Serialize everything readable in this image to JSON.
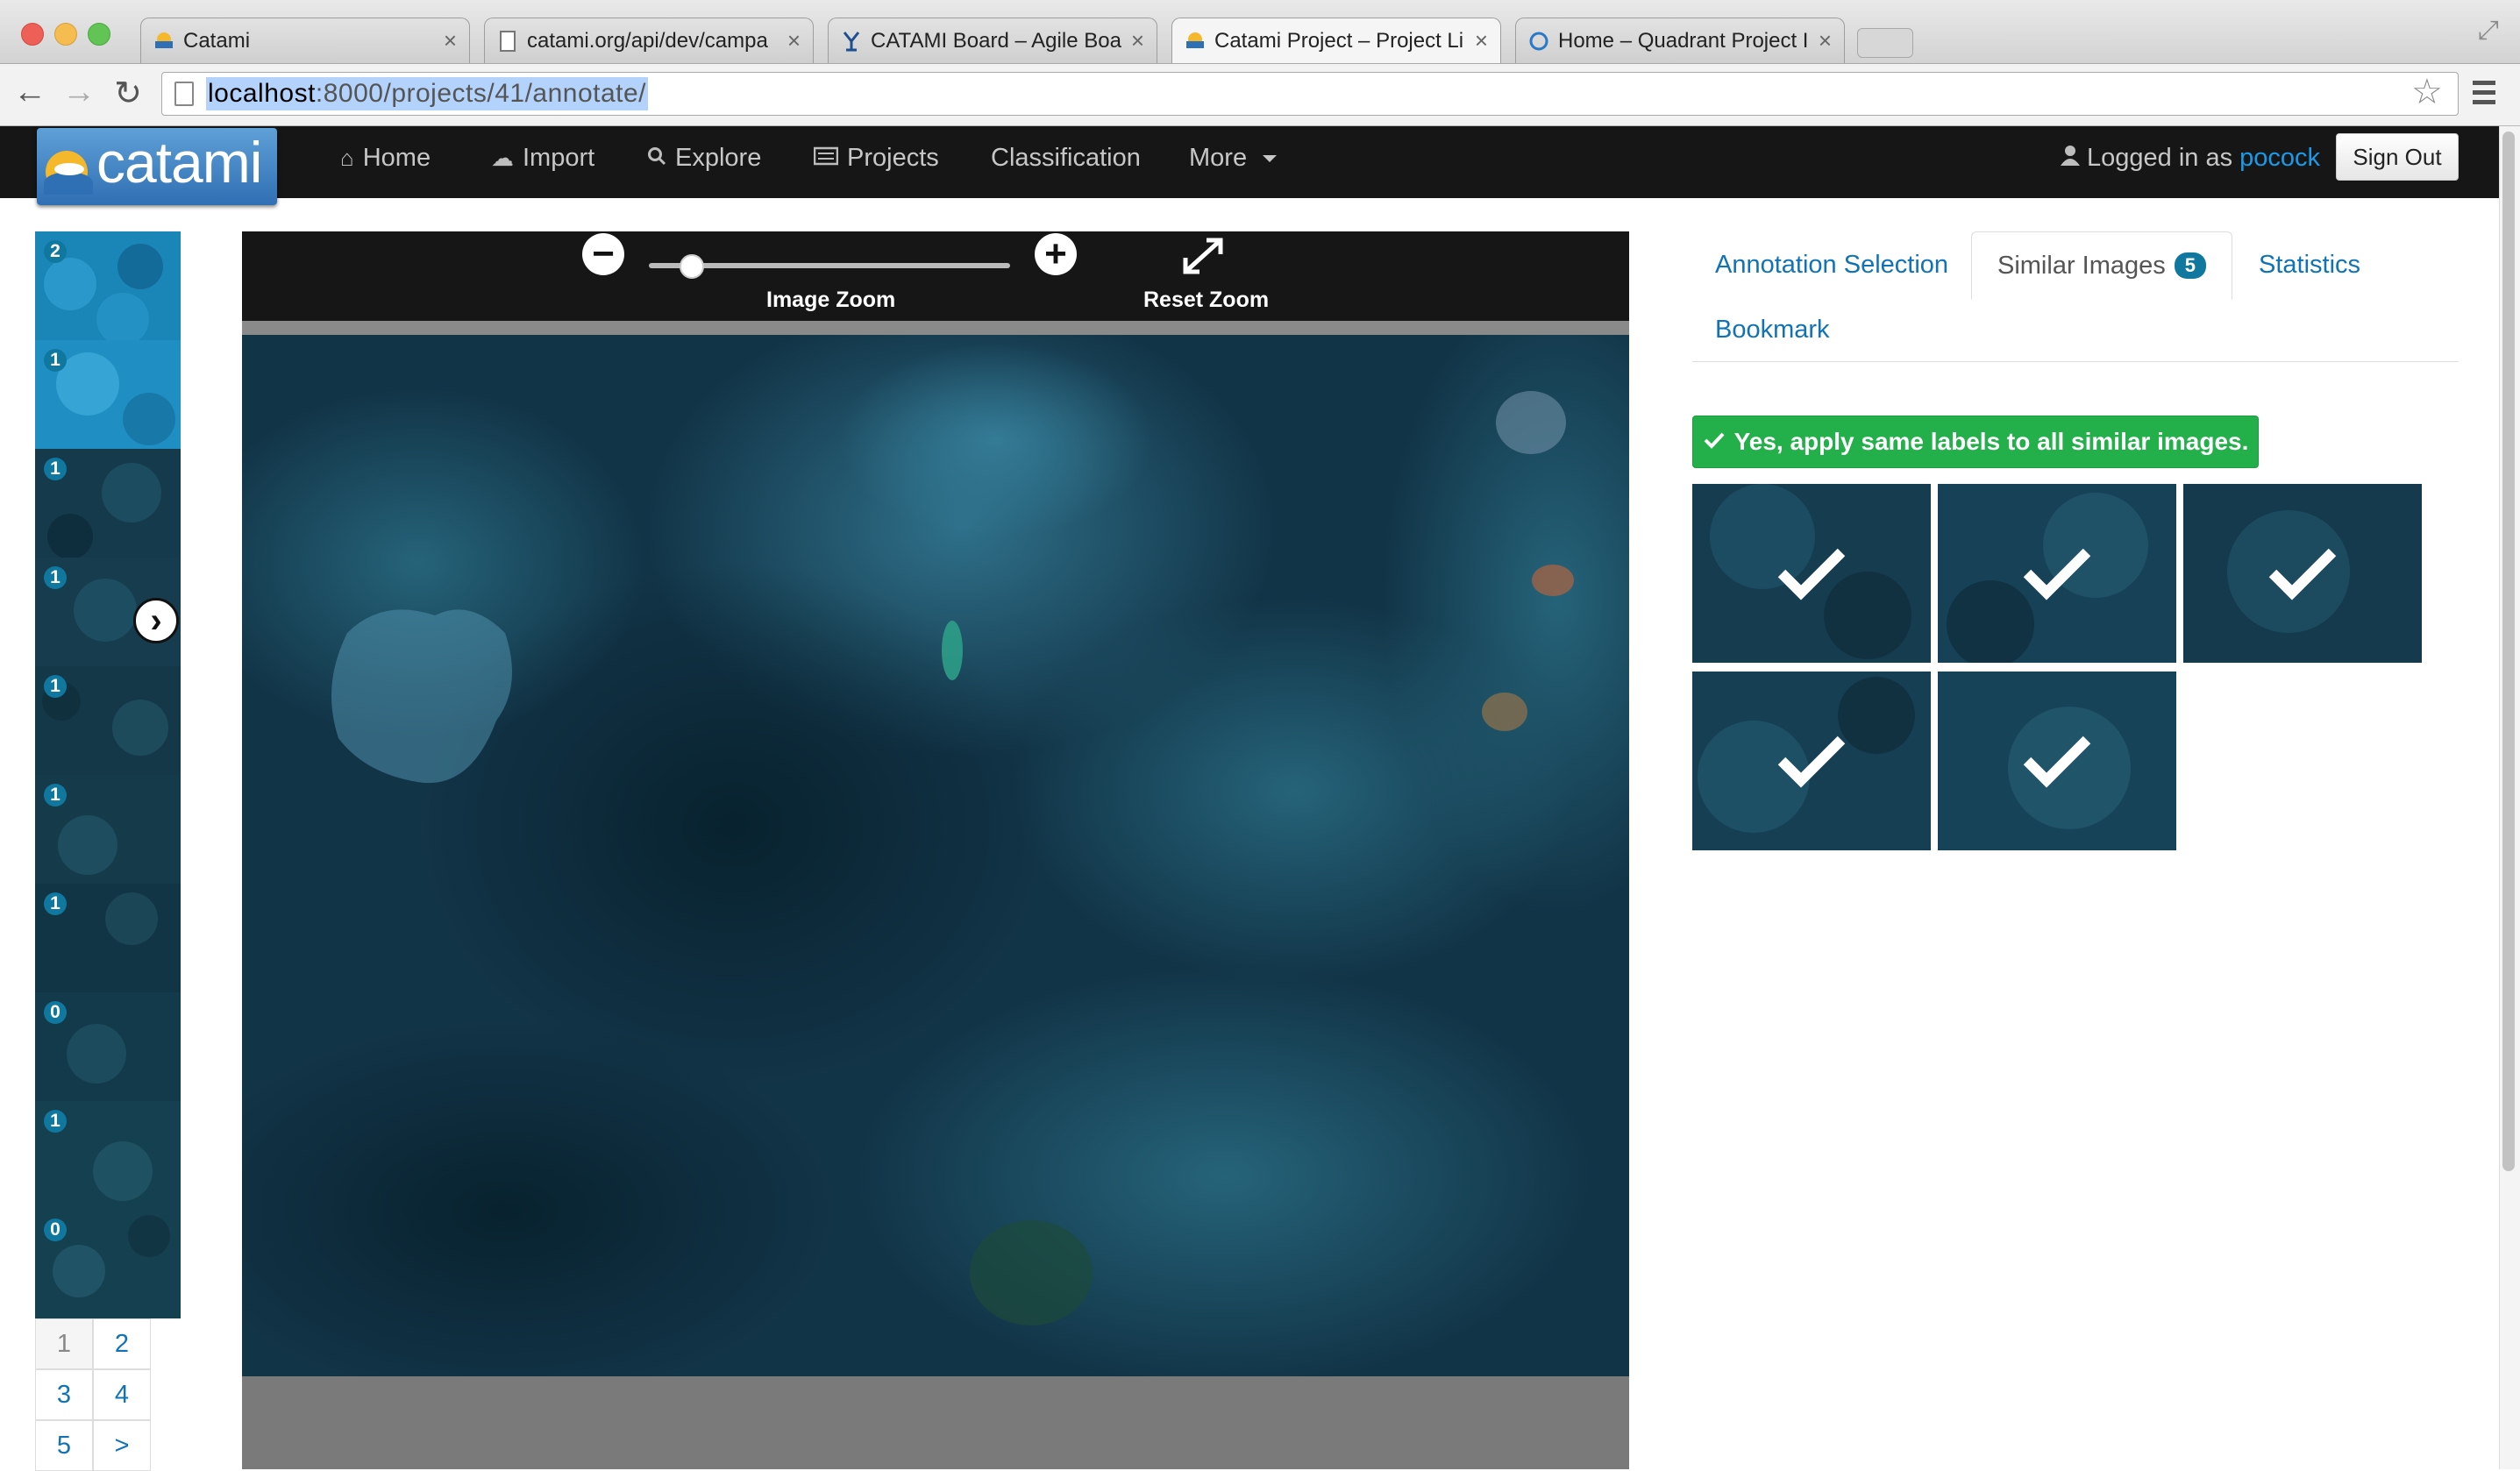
{
  "browser": {
    "tabs": [
      {
        "title": "Catami",
        "favicon": "catami-logo-icon"
      },
      {
        "title": "catami.org/api/dev/campa",
        "favicon": "page-icon"
      },
      {
        "title": "CATAMI Board – Agile Boa",
        "favicon": "agile-board-icon"
      },
      {
        "title": "Catami Project – Project Li",
        "favicon": "catami-logo-icon"
      },
      {
        "title": "Home – Quadrant Project I",
        "favicon": "quadrant-icon"
      }
    ],
    "active_tab": 3,
    "url_host": "localhost",
    "url_path": ":8000/projects/41/annotate/"
  },
  "app": {
    "logo_text": "catami",
    "nav": {
      "home": "Home",
      "import": "Import",
      "explore": "Explore",
      "projects": "Projects",
      "classification": "Classification",
      "more": "More"
    },
    "logged_in_prefix": "Logged in as",
    "username": "pocock",
    "sign_out": "Sign Out"
  },
  "thumbnails": {
    "badges": [
      "2",
      "1",
      "1",
      "1",
      "1",
      "1",
      "1",
      "0",
      "1",
      "0"
    ],
    "pages": [
      "1",
      "2",
      "3",
      "4",
      "5",
      ">"
    ],
    "current_page": "1"
  },
  "viewer": {
    "zoom_label": "Image Zoom",
    "reset_label": "Reset Zoom",
    "zoom_level": 0.12
  },
  "panel": {
    "tabs": {
      "annotation_selection": "Annotation Selection",
      "similar_images": "Similar Images",
      "similar_count": "5",
      "statistics": "Statistics",
      "bookmark": "Bookmark"
    },
    "apply_button": "Yes, apply same labels to all similar images.",
    "similar_images_selected": [
      true,
      true,
      true,
      true,
      true
    ]
  },
  "colors": {
    "navbar": "#161616",
    "link": "#1173b5",
    "badge": "#10789f",
    "success": "#23b04a",
    "water": "#123447"
  }
}
